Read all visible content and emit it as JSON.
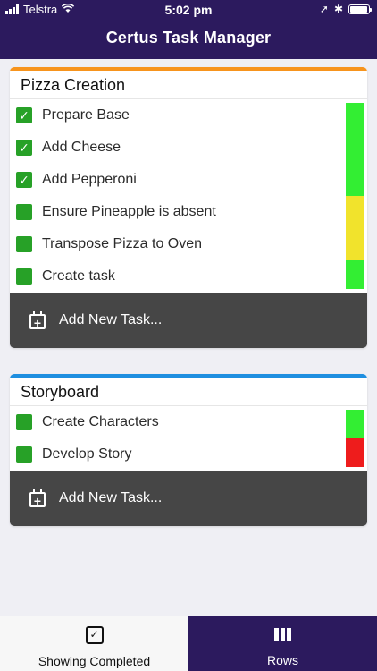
{
  "status_bar": {
    "carrier": "Telstra",
    "time": "5:02 pm",
    "wifi_icon": "wifi-icon",
    "location_icon": "➚",
    "bluetooth_icon": "✱",
    "battery_level": 0.95
  },
  "header": {
    "title": "Certus Task Manager"
  },
  "lists": [
    {
      "title": "Pizza Creation",
      "accent_color": "#f7941d",
      "tasks": [
        {
          "label": "Prepare Base",
          "completed": true,
          "status_color": "#33ee33"
        },
        {
          "label": "Add Cheese",
          "completed": true,
          "status_color": "#33ee33"
        },
        {
          "label": "Add Pepperoni",
          "completed": true,
          "status_color": "#33ee33"
        },
        {
          "label": "Ensure Pineapple is absent",
          "completed": false,
          "status_color": "#f1e32c"
        },
        {
          "label": "Transpose Pizza to Oven",
          "completed": false,
          "status_color": "#f1e32c"
        },
        {
          "label": "Create task",
          "completed": false,
          "status_color": "#33ee33"
        }
      ],
      "add_label": "Add New Task..."
    },
    {
      "title": "Storyboard",
      "accent_color": "#1f8fe0",
      "tasks": [
        {
          "label": "Create Characters",
          "completed": false,
          "status_color": "#33ee33"
        },
        {
          "label": "Develop Story",
          "completed": false,
          "status_color": "#ee1c1c"
        }
      ],
      "add_label": "Add New Task..."
    }
  ],
  "tabs": [
    {
      "label": "Showing Completed",
      "icon": "calendar-check-icon",
      "active": false
    },
    {
      "label": "Rows",
      "icon": "rows-icon",
      "active": true
    }
  ],
  "colors": {
    "brand": "#2c1a5e",
    "check": "#27a127",
    "add_bar": "#464646"
  }
}
